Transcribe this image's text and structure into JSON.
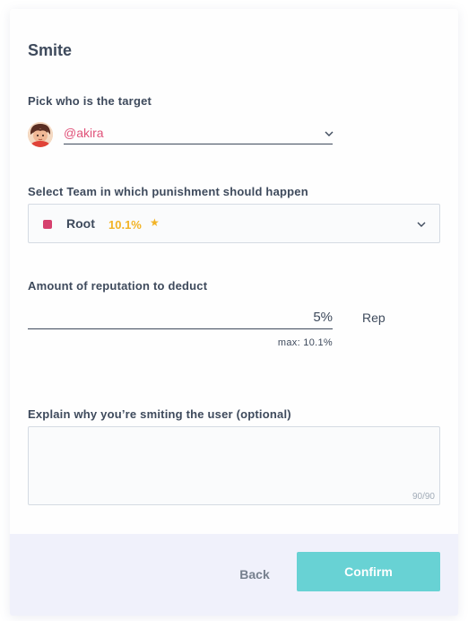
{
  "dialog": {
    "title": "Smite"
  },
  "target": {
    "label": "Pick who is the target",
    "selected_user": "@akira",
    "avatar_icon": "user-avatar",
    "dropdown_icon": "chevron-down-icon"
  },
  "team": {
    "label": "Select Team in which punishment should happen",
    "selected_team": "Root",
    "team_color": "#d6416e",
    "reputation": "10.1%",
    "star_icon": "star-icon",
    "dropdown_icon": "chevron-down-icon"
  },
  "amount": {
    "label": "Amount of reputation to deduct",
    "value": "5%",
    "unit": "Rep",
    "max_text": "max: 10.1%"
  },
  "explanation": {
    "label": "Explain why you’re smiting the user (optional)",
    "value": "",
    "char_count": "90/90"
  },
  "footer": {
    "back_label": "Back",
    "confirm_label": "Confirm",
    "confirm_color": "#68d2d4"
  }
}
